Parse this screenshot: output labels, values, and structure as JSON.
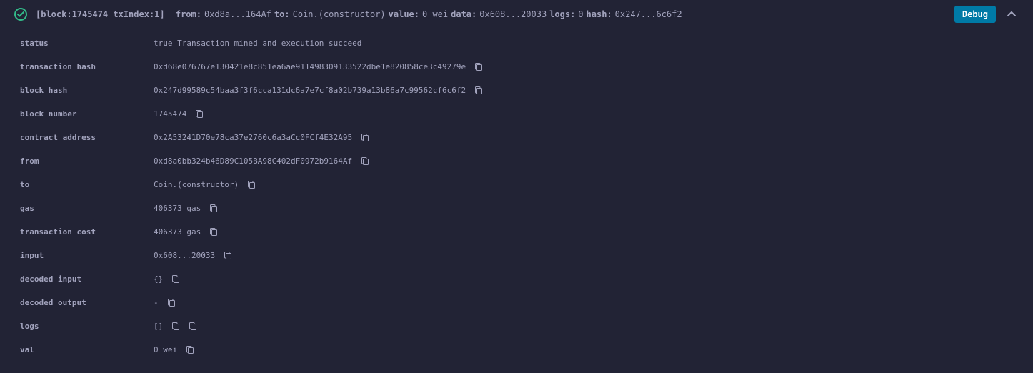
{
  "header": {
    "block_label": "[block:1745474 txIndex:1]",
    "from_label": "from:",
    "from_value": "0xd8a...164Af",
    "to_label": "to:",
    "to_value": "Coin.(constructor)",
    "value_label": "value:",
    "value_value": "0 wei",
    "data_label": "data:",
    "data_value": "0x608...20033",
    "logs_label": "logs:",
    "logs_value": "0",
    "hash_label": "hash:",
    "hash_value": "0x247...6c6f2",
    "debug_label": "Debug"
  },
  "details": {
    "status": {
      "label": "status",
      "value": "true Transaction mined and execution succeed"
    },
    "transaction_hash": {
      "label": "transaction hash",
      "value": "0xd68e076767e130421e8c851ea6ae911498309133522dbe1e820858ce3c49279e"
    },
    "block_hash": {
      "label": "block hash",
      "value": "0x247d99589c54baa3f3f6cca131dc6a7e7cf8a02b739a13b86a7c99562cf6c6f2"
    },
    "block_number": {
      "label": "block number",
      "value": "1745474"
    },
    "contract_address": {
      "label": "contract address",
      "value": "0x2A53241D70e78ca37e2760c6a3aCc0FCf4E32A95"
    },
    "from": {
      "label": "from",
      "value": "0xd8a0bb324b46D89C105BA98C402dF0972b9164Af"
    },
    "to": {
      "label": "to",
      "value": "Coin.(constructor)"
    },
    "gas": {
      "label": "gas",
      "value": "406373 gas"
    },
    "transaction_cost": {
      "label": "transaction cost",
      "value": "406373 gas"
    },
    "input": {
      "label": "input",
      "value": "0x608...20033"
    },
    "decoded_input": {
      "label": "decoded input",
      "value": "{}"
    },
    "decoded_output": {
      "label": "decoded output",
      "value": " - "
    },
    "logs": {
      "label": "logs",
      "value": "[]"
    },
    "val": {
      "label": "val",
      "value": "0 wei"
    }
  }
}
